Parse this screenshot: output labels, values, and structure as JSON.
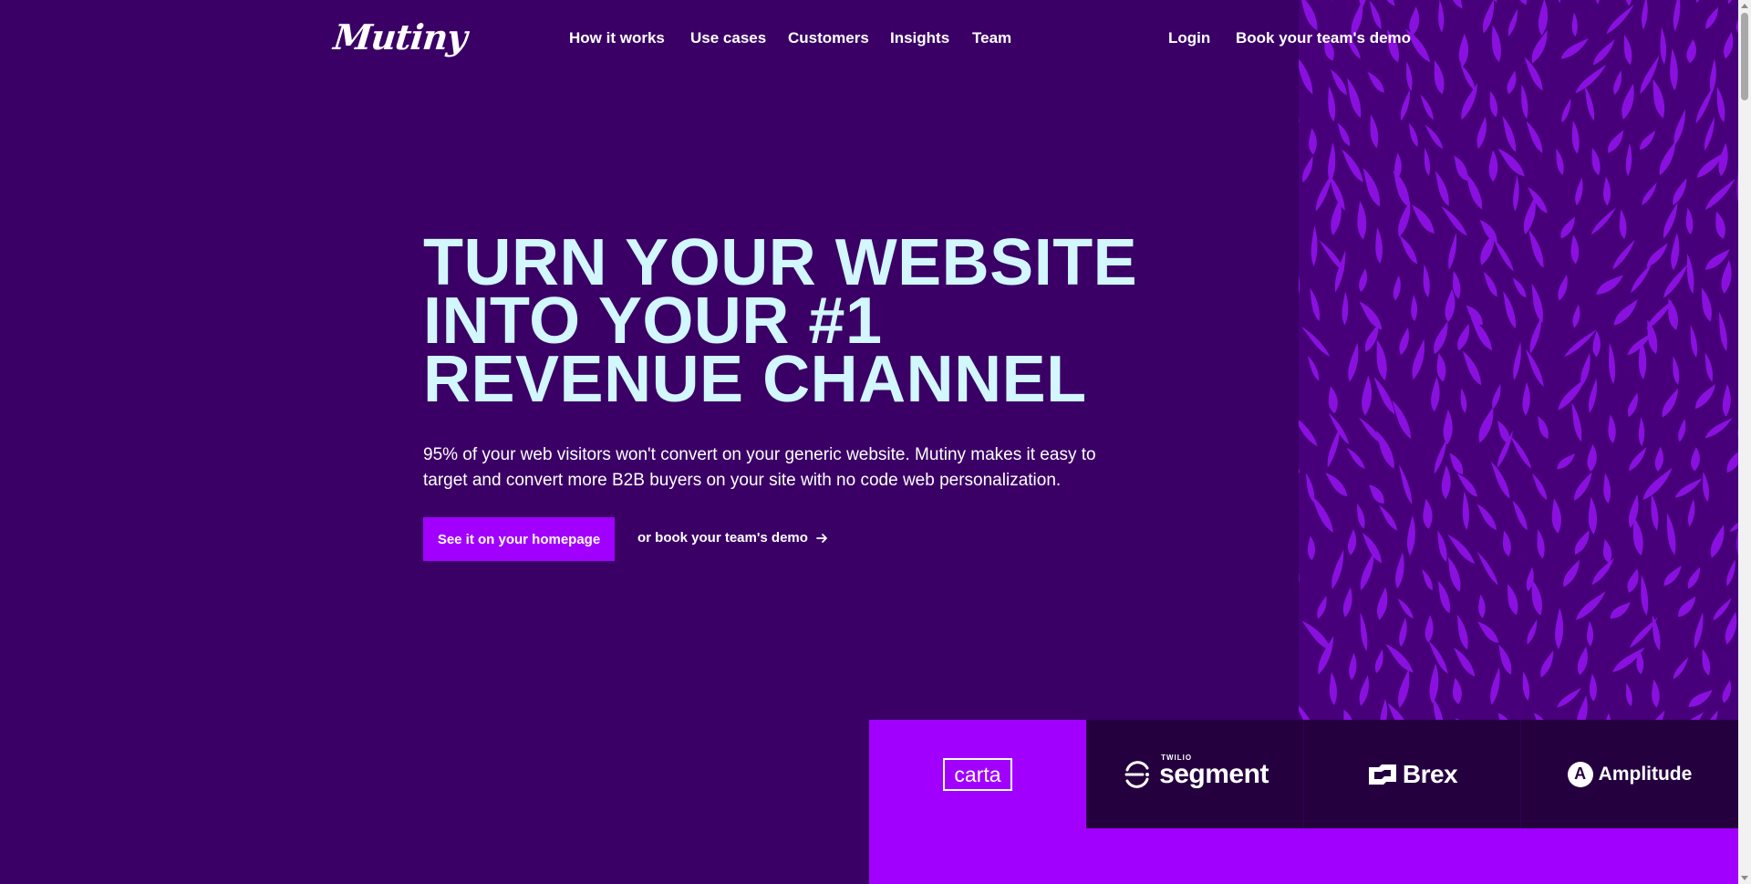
{
  "brand": {
    "logo_text": "Mutiny"
  },
  "nav": {
    "items": [
      {
        "label": "How it works"
      },
      {
        "label": "Use cases"
      },
      {
        "label": "Customers"
      },
      {
        "label": "Insights"
      },
      {
        "label": "Team"
      }
    ],
    "login": "Login",
    "demo": "Book your team's demo"
  },
  "hero": {
    "title_lines": [
      "TURN YOUR WEBSITE",
      "INTO YOUR #1",
      "REVENUE CHANNEL"
    ],
    "subtitle": "95% of your web visitors won't convert on your generic website. Mutiny makes it easy to target and convert more B2B buyers on your site with no code web personalization.",
    "cta_primary": "See it on your homepage",
    "cta_secondary": "or book your team's demo",
    "cta_secondary_icon": "arrow-right-icon"
  },
  "customers": {
    "logos": [
      {
        "name": "carta"
      },
      {
        "name": "segment",
        "prefix": "TWILIO"
      },
      {
        "name": "Brex"
      },
      {
        "name": "Amplitude"
      }
    ]
  },
  "colors": {
    "background": "#3a0066",
    "headline": "#d2f7ff",
    "accent": "#a100ff",
    "logo_tile": "#24003f",
    "pattern": "#8a10e0"
  }
}
